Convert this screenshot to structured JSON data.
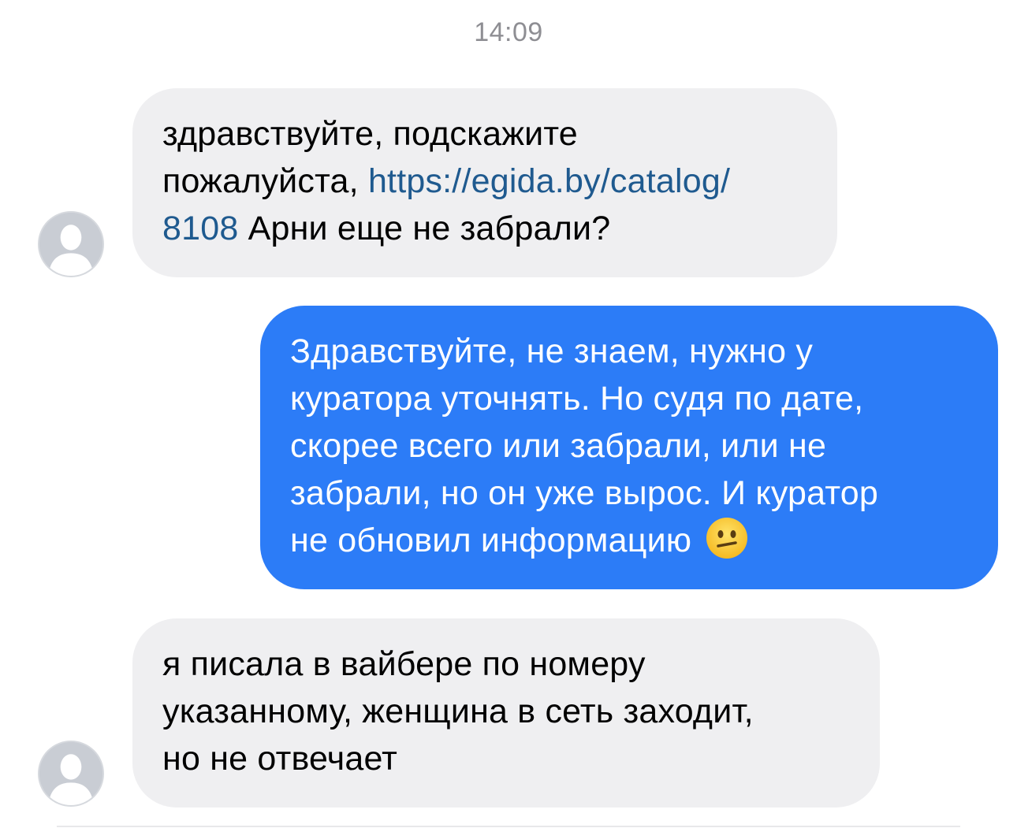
{
  "chat": {
    "timestamp": "14:09",
    "messages": [
      {
        "direction": "incoming",
        "line1": "здравствуйте, подскажите",
        "line2_text": "пожалуйста, ",
        "line2_link": "https://egida.by/catalog/",
        "line3_link": "8108",
        "line3_text": " Арни еще не забрали?"
      },
      {
        "direction": "outgoing",
        "lines": [
          "Здравствуйте, не знаем, нужно у",
          "куратора уточнять. Но судя по дате,",
          "скорее всего или забрали, или не",
          "забрали, но он уже вырос. И куратор",
          "не обновил информацию"
        ],
        "emoji": "confused-face-emoji"
      },
      {
        "direction": "incoming",
        "lines": [
          "я писала в вайбере по номеру",
          "указанному, женщина в сеть заходит,",
          "но не отвечает"
        ]
      }
    ]
  },
  "colors": {
    "incoming_bubble": "#efeff1",
    "outgoing_bubble": "#2c7cf7",
    "link": "#1f5a8f",
    "timestamp": "#8e8e93"
  },
  "icons": {
    "avatar": "default-user-avatar-icon"
  }
}
